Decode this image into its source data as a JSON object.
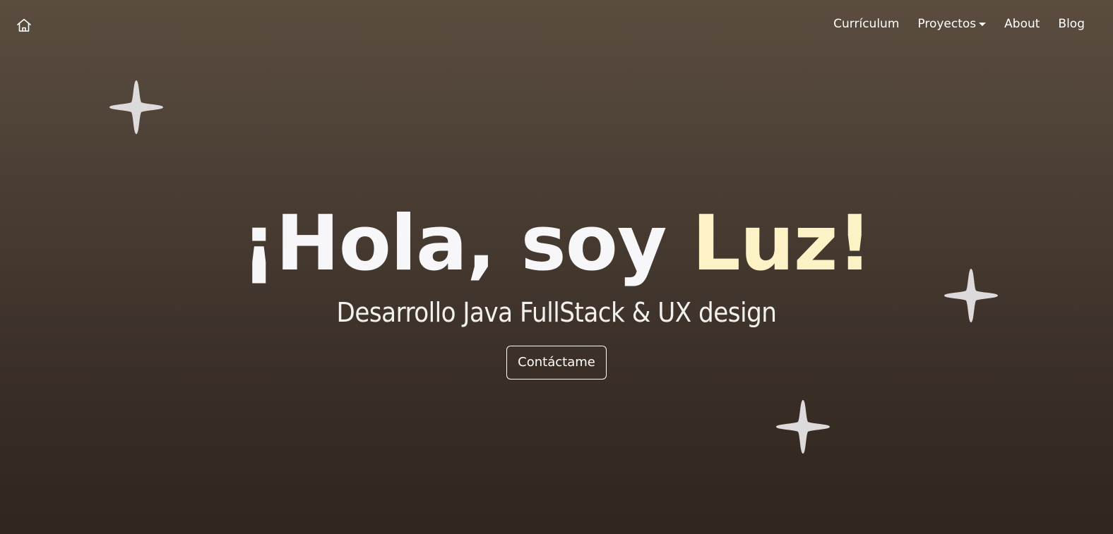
{
  "navbar": {
    "home_icon": "home-icon",
    "items": [
      {
        "label": "Currículum"
      },
      {
        "label": "Proyectos",
        "has_dropdown": true
      },
      {
        "label": "About"
      },
      {
        "label": "Blog"
      }
    ]
  },
  "hero": {
    "title_prefix": "¡Hola, soy ",
    "title_name": "Luz!",
    "subtitle": "Desarrollo Java FullStack & UX design",
    "cta_label": "Contáctame"
  },
  "decorations": {
    "sparkle_icon": "sparkle-icon",
    "sparkle_color": "#dcdadb"
  },
  "colors": {
    "background_top": "#5b4c3f",
    "background_bottom": "#30261f",
    "accent": "#fdf2c6",
    "text": "#ffffff"
  }
}
